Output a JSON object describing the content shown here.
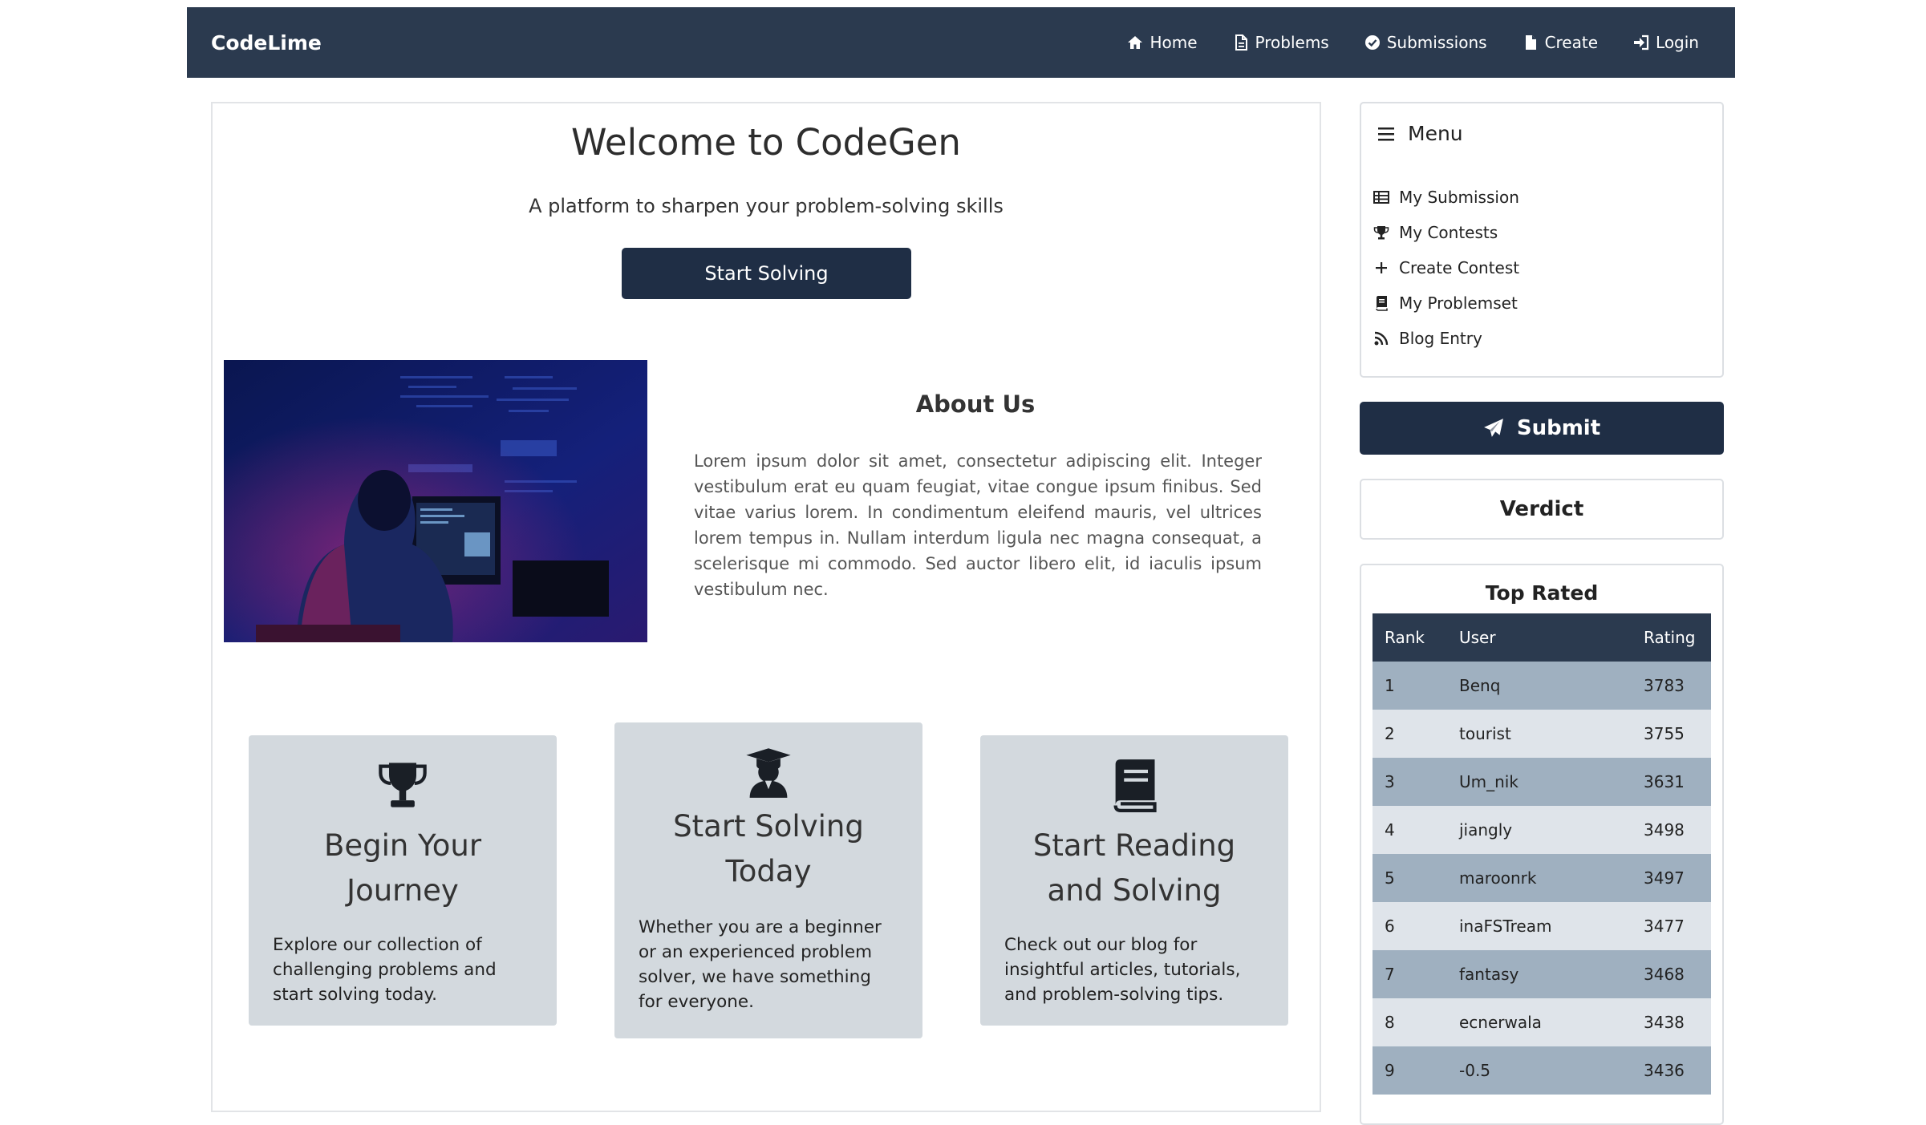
{
  "navbar": {
    "brand": "CodeLime",
    "links": [
      {
        "label": "Home",
        "icon": "home-icon"
      },
      {
        "label": "Problems",
        "icon": "file-icon"
      },
      {
        "label": "Submissions",
        "icon": "check-circle-icon"
      },
      {
        "label": "Create",
        "icon": "document-icon"
      },
      {
        "label": "Login",
        "icon": "login-icon"
      }
    ]
  },
  "hero": {
    "title": "Welcome to CodeGen",
    "subtitle": "A platform to sharpen your problem-solving skills",
    "cta_label": "Start Solving"
  },
  "about": {
    "title": "About Us",
    "text": "Lorem ipsum dolor sit amet, consectetur adipiscing elit. Integer vestibulum erat eu quam feugiat, vitae congue ipsum finibus. Sed vitae varius lorem. In condimentum eleifend mauris, vel ultrices lorem tempus in. Nullam interdum ligula nec magna consequat, a scelerisque mi commodo. Sed auctor libero elit, id iaculis ipsum vestibulum nec."
  },
  "cards": [
    {
      "icon": "trophy-icon",
      "title": "Begin Your Journey",
      "text": "Explore our collection of challenging problems and start solving today."
    },
    {
      "icon": "graduate-icon",
      "title": "Start Solving Today",
      "text": "Whether you are a beginner or an experienced problem solver, we have something for everyone."
    },
    {
      "icon": "book-icon",
      "title": "Start Reading and Solving",
      "text": "Check out our blog for insightful articles, tutorials, and problem-solving tips."
    }
  ],
  "sidebar": {
    "menu_title": "Menu",
    "menu_items": [
      {
        "label": "My Submission",
        "icon": "table-icon"
      },
      {
        "label": "My Contests",
        "icon": "trophy-icon"
      },
      {
        "label": "Create Contest",
        "icon": "plus-icon"
      },
      {
        "label": "My Problemset",
        "icon": "book-icon"
      },
      {
        "label": "Blog Entry",
        "icon": "rss-icon"
      }
    ],
    "submit_label": "Submit",
    "verdict_label": "Verdict"
  },
  "top_rated": {
    "title": "Top Rated",
    "headers": [
      "Rank",
      "User",
      "Rating"
    ],
    "rows": [
      [
        "1",
        "Benq",
        "3783"
      ],
      [
        "2",
        "tourist",
        "3755"
      ],
      [
        "3",
        "Um_nik",
        "3631"
      ],
      [
        "4",
        "jiangly",
        "3498"
      ],
      [
        "5",
        "maroonrk",
        "3497"
      ],
      [
        "6",
        "inaFSTream",
        "3477"
      ],
      [
        "7",
        "fantasy",
        "3468"
      ],
      [
        "8",
        "ecnerwala",
        "3438"
      ],
      [
        "9",
        "-0.5",
        "3436"
      ]
    ]
  },
  "colors": {
    "navbar_bg": "#2b3a4f",
    "button_bg": "#1f2e45",
    "card_bg": "#d3d9de",
    "row_dark": "#9fb0c0",
    "row_light": "#dfe4ea"
  }
}
